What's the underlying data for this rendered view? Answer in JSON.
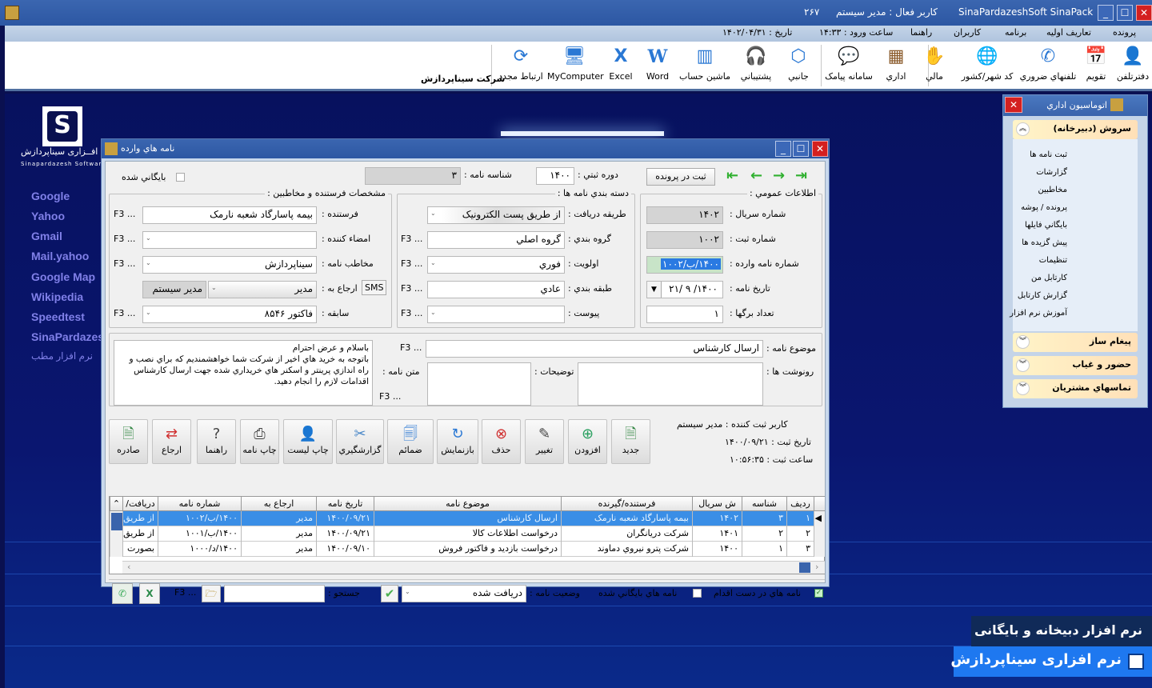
{
  "titlebar": {
    "app_name": "SinaPardazeshSoft SinaPack",
    "active_user": "کاربر فعال : مدير سيستم",
    "counter": "۲۶۷"
  },
  "menu": {
    "items": [
      "پرونده",
      "تعاريف اوليه",
      "برنامه",
      "کاربران",
      "راهنما"
    ],
    "login_time": "ساعت ورود : ۱۴:۳۳",
    "date": "تاريخ : ۱۴۰۲/۰۴/۳۱"
  },
  "toolbar": {
    "company": "شرکت سيناپردازش",
    "buttons": [
      {
        "label": "دفترتلفن",
        "icon": "phonebook-icon"
      },
      {
        "label": "تقويم",
        "icon": "calendar-icon"
      },
      {
        "label": "تلفنهاي ضروري",
        "icon": "phone-icon"
      },
      {
        "label": "کد شهر/کشور",
        "icon": "globe-icon"
      },
      {
        "label": "مالي",
        "icon": "finance-icon"
      },
      {
        "label": "اداري",
        "icon": "building-icon"
      },
      {
        "label": "سامانه پيامک",
        "icon": "sms-icon"
      },
      {
        "label": "جانبي",
        "icon": "box-icon"
      },
      {
        "label": "پشتيباني",
        "icon": "headset-icon"
      },
      {
        "label": "ماشين حساب",
        "icon": "calculator-icon"
      },
      {
        "label": "Word",
        "icon": "word-icon"
      },
      {
        "label": "Excel",
        "icon": "excel-icon"
      },
      {
        "label": "MyComputer",
        "icon": "computer-icon"
      },
      {
        "label": "ارتباط مجدد",
        "icon": "reconnect-icon"
      }
    ]
  },
  "desktop": {
    "brand_fa": "نرم افــزاری سيناپردازش",
    "brand_en": "Sinapardazesh Software",
    "links": [
      "Google",
      "Yahoo",
      "Gmail",
      "Mail.yahoo",
      "Google Map",
      "Wikipedia",
      "Speedtest",
      "SinaPardazesh",
      "نرم افزار مطب"
    ],
    "promo_line1": "نرم افزار دبيخانه و بايگانی",
    "promo_line2": "نرم افزاری سيناپردازش"
  },
  "right_panel": {
    "title": "اتوماسيون اداري",
    "group_open": "سروش (دبيرخانه)",
    "items": [
      "ثبت نامه ها",
      "گزارشات",
      "مخاطبين",
      "پرونده / پوشه",
      "بايگاني فايلها",
      "پيش گزيده ها",
      "تنظيمات",
      "کارتابل من",
      "گزارش کارتابل",
      "آموزش نرم افزار"
    ],
    "groups_closed": [
      "پيغام ساز",
      "حضور و غياب",
      "تماسهاي مشتريان"
    ]
  },
  "dialog": {
    "title": "نامه هاي وارده",
    "archived_label": "بايگاني شده",
    "letter_id_label": "شناسه نامه :",
    "letter_id": "۳",
    "period_label": "دوره ثبتي :",
    "period": "۱۴۰۰",
    "file_button": "ثبت در پرونده",
    "general": {
      "legend": "اطلاعات عمومي :",
      "serial_label": "شماره سريال :",
      "serial": "۱۴۰۲",
      "reg_label": "شماره ثبت :",
      "reg": "۱۰۰۲",
      "incoming_label": "شماره نامه وارده :",
      "incoming": "۱۴۰۰/ب/۱۰۰۲",
      "date_label": "تاريخ نامه :",
      "date": "۱۴۰۰/ ۹ /۲۱",
      "pages_label": "تعداد برگها :",
      "pages": "۱"
    },
    "category": {
      "legend": "دسته بندي نامه ها :",
      "receive_label": "طريقه دريافت :",
      "receive": "از طريق پست الکترونيک",
      "group_label": "گروه بندي :",
      "group": "گروه اصلي",
      "priority_label": "اولويت :",
      "priority": "فوري",
      "class_label": "طبقه بندي :",
      "class": "عادي",
      "attach_label": "پيوست :",
      "attach": ""
    },
    "sender": {
      "legend": "مشخصات فرستنده و مخاطبين :",
      "sender_label": "فرستنده :",
      "sender": "بيمه پاسارگاد شعبه نارمک",
      "signer_label": "امضاء کننده :",
      "signer": "",
      "recipient_label": "مخاطب نامه :",
      "recipient": "سيناپردازش",
      "refer_label": "ارجاع به :",
      "refer": "مدير",
      "refer_user": "مدير سيستم",
      "sms": "SMS",
      "history_label": "سابقه :",
      "history": "فاکتور ۸۵۴۶"
    },
    "subject_label": "موضوع نامه :",
    "subject": "ارسال کارشناس",
    "cc_label": "رونوشت ها :",
    "notes_label": "توضيحات :",
    "body_label": "متن نامه :",
    "body": "باسلام و عرض احترام\nباتوجه به خريد هاي اخير از شرکت شما خواهشمنديم که براي نصب و راه اندازي پرينتر و اسکنر هاي خريداري شده جهت ارسال کارشناس اقدامات لازم را انجام دهيد.",
    "f3": "F3 ...",
    "meta": {
      "user": "کاربر ثبت کننده : مدير سيستم",
      "date": "تاريخ ثبت : ۱۴۰۰/۰۹/۲۱",
      "time": "ساعت ثبت : ۱۰:۵۶:۳۵"
    },
    "actions": [
      "جديد",
      "افزودن",
      "تغيير",
      "حذف",
      "بازنمايش",
      "ضمائم",
      "گزارشگيري",
      "چاپ ليست",
      "چاپ نامه",
      "راهنما",
      "ارجاع",
      "صادره"
    ],
    "grid": {
      "columns": [
        "رديف",
        "شناسه",
        "ش سريال",
        "فرستنده/گيرنده",
        "موضوع نامه",
        "تاريخ نامه",
        "ارجاع به",
        "شماره نامه",
        "دريافت/"
      ],
      "rows": [
        [
          "۱",
          "۳",
          "۱۴۰۲",
          "بيمه پاسارگاد شعبه نارمک",
          "ارسال کارشناس",
          "۱۴۰۰/۰۹/۲۱",
          "مدير",
          "۱۴۰۰/ب/۱۰۰۲",
          "از طريق"
        ],
        [
          "۲",
          "۲",
          "۱۴۰۱",
          "شرکت دريانگران",
          "درخواست اطلاعات کالا",
          "۱۴۰۰/۰۹/۲۱",
          "مدير",
          "۱۴۰۰/ب/۱۰۰۱",
          "از طريق"
        ],
        [
          "۳",
          "۱",
          "۱۴۰۰",
          "شرکت پترو نيروي دماوند",
          "درخواست بازديد و فاکتور فروش",
          "۱۴۰۰/۰۹/۱۰",
          "مدير",
          "۱۴۰۰/د/۱۰۰۰",
          "بصورت"
        ]
      ],
      "selected_row": 0
    },
    "footer": {
      "pending_label": "نامه هاي در دست اقدام",
      "pending_checked": true,
      "archived_label": "نامه هاي بايگاني شده",
      "archived_checked": false,
      "status_label": "وضعيت نامه :",
      "status": "دريافت شده",
      "search_label": "جستجو :",
      "search_value": ""
    }
  }
}
